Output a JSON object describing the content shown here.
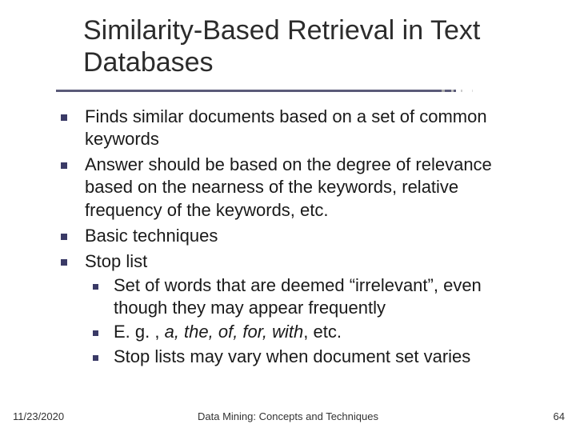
{
  "title": "Similarity-Based Retrieval in Text Databases",
  "bullets": [
    {
      "text": "Finds similar documents based on a set of common keywords"
    },
    {
      "text": "Answer should be based on the degree of relevance based on the nearness of the keywords, relative frequency of the keywords, etc."
    },
    {
      "text": "Basic techniques"
    },
    {
      "text": "Stop list",
      "sub": [
        {
          "text": "Set of words that are deemed “irrelevant”, even though they may appear frequently"
        },
        {
          "prefix": "E. g. , ",
          "italic": "a, the, of, for, with",
          "suffix": ", etc."
        },
        {
          "text": "Stop lists may vary when document set varies"
        }
      ]
    }
  ],
  "footer": {
    "date": "11/23/2020",
    "center": "Data Mining: Concepts and Techniques",
    "page": "64"
  }
}
